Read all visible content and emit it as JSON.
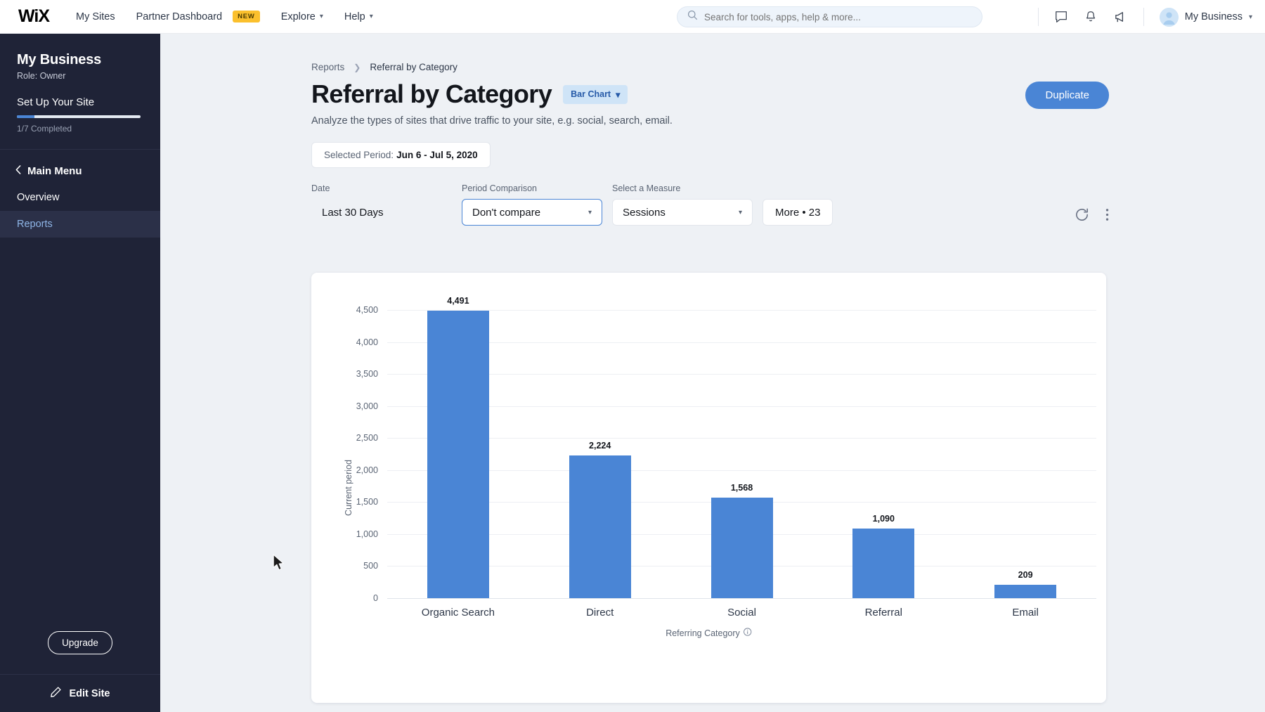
{
  "topbar": {
    "logo": "WiX",
    "nav": [
      {
        "label": "My Sites",
        "badge": null,
        "caret": false
      },
      {
        "label": "Partner Dashboard",
        "badge": "NEW",
        "caret": false
      },
      {
        "label": "Explore",
        "badge": null,
        "caret": true
      },
      {
        "label": "Help",
        "badge": null,
        "caret": true
      }
    ],
    "search_placeholder": "Search for tools, apps, help & more...",
    "icons": [
      "chat-icon",
      "bell-icon",
      "megaphone-icon"
    ],
    "user_name": "My Business"
  },
  "sidebar": {
    "business_name": "My Business",
    "role": "Role: Owner",
    "setup_label": "Set Up Your Site",
    "progress_text": "1/7 Completed",
    "progress_percent": 14,
    "main_menu": "Main Menu",
    "items": [
      {
        "label": "Overview",
        "active": false
      },
      {
        "label": "Reports",
        "active": true
      }
    ],
    "upgrade_label": "Upgrade",
    "edit_site_label": "Edit Site"
  },
  "main": {
    "breadcrumb": {
      "parent": "Reports",
      "current": "Referral by Category"
    },
    "page_title": "Referral by Category",
    "chart_type_badge": "Bar Chart",
    "subtitle": "Analyze the types of sites that drive traffic to your site, e.g. social, search, email.",
    "duplicate_label": "Duplicate",
    "period_chip": {
      "prefix": "Selected Period:",
      "value": "Jun 6 - Jul 5, 2020"
    },
    "controls": [
      {
        "label": "Date",
        "value": "Last 30 Days",
        "style": "plain",
        "caret": false
      },
      {
        "label": "Period Comparison",
        "value": "Don't compare",
        "style": "boxed",
        "caret": true
      },
      {
        "label": "Select a Measure",
        "value": "Sessions",
        "style": "light",
        "caret": true
      }
    ],
    "more_label": "More • 23",
    "refresh_icon": "refresh-icon",
    "overflow_icon": "more-vertical-icon"
  },
  "chart_data": {
    "type": "bar",
    "title": "Referral by Category",
    "categories": [
      "Organic Search",
      "Direct",
      "Social",
      "Referral",
      "Email"
    ],
    "values": [
      4491,
      2224,
      1568,
      1090,
      209
    ],
    "value_labels": [
      "4,491",
      "2,224",
      "1,568",
      "1,090",
      "209"
    ],
    "xlabel": "Referring Category",
    "xlabel_info_icon": "info-icon",
    "ylabel": "Current period",
    "ylim": [
      0,
      4500
    ],
    "ytick_values": [
      0,
      500,
      1000,
      1500,
      2000,
      2500,
      3000,
      3500,
      4000,
      4500
    ],
    "ytick_labels": [
      "0",
      "500",
      "1,000",
      "1,500",
      "2,000",
      "2,500",
      "3,000",
      "3,500",
      "4,000",
      "4,500"
    ],
    "bar_color": "#4a85d5",
    "grid": true,
    "legend": false
  },
  "colors": {
    "accent": "#4a85d5",
    "sidebar_bg": "#1f2337",
    "badge_yellow": "#fbc02d",
    "page_bg": "#eef1f5"
  }
}
